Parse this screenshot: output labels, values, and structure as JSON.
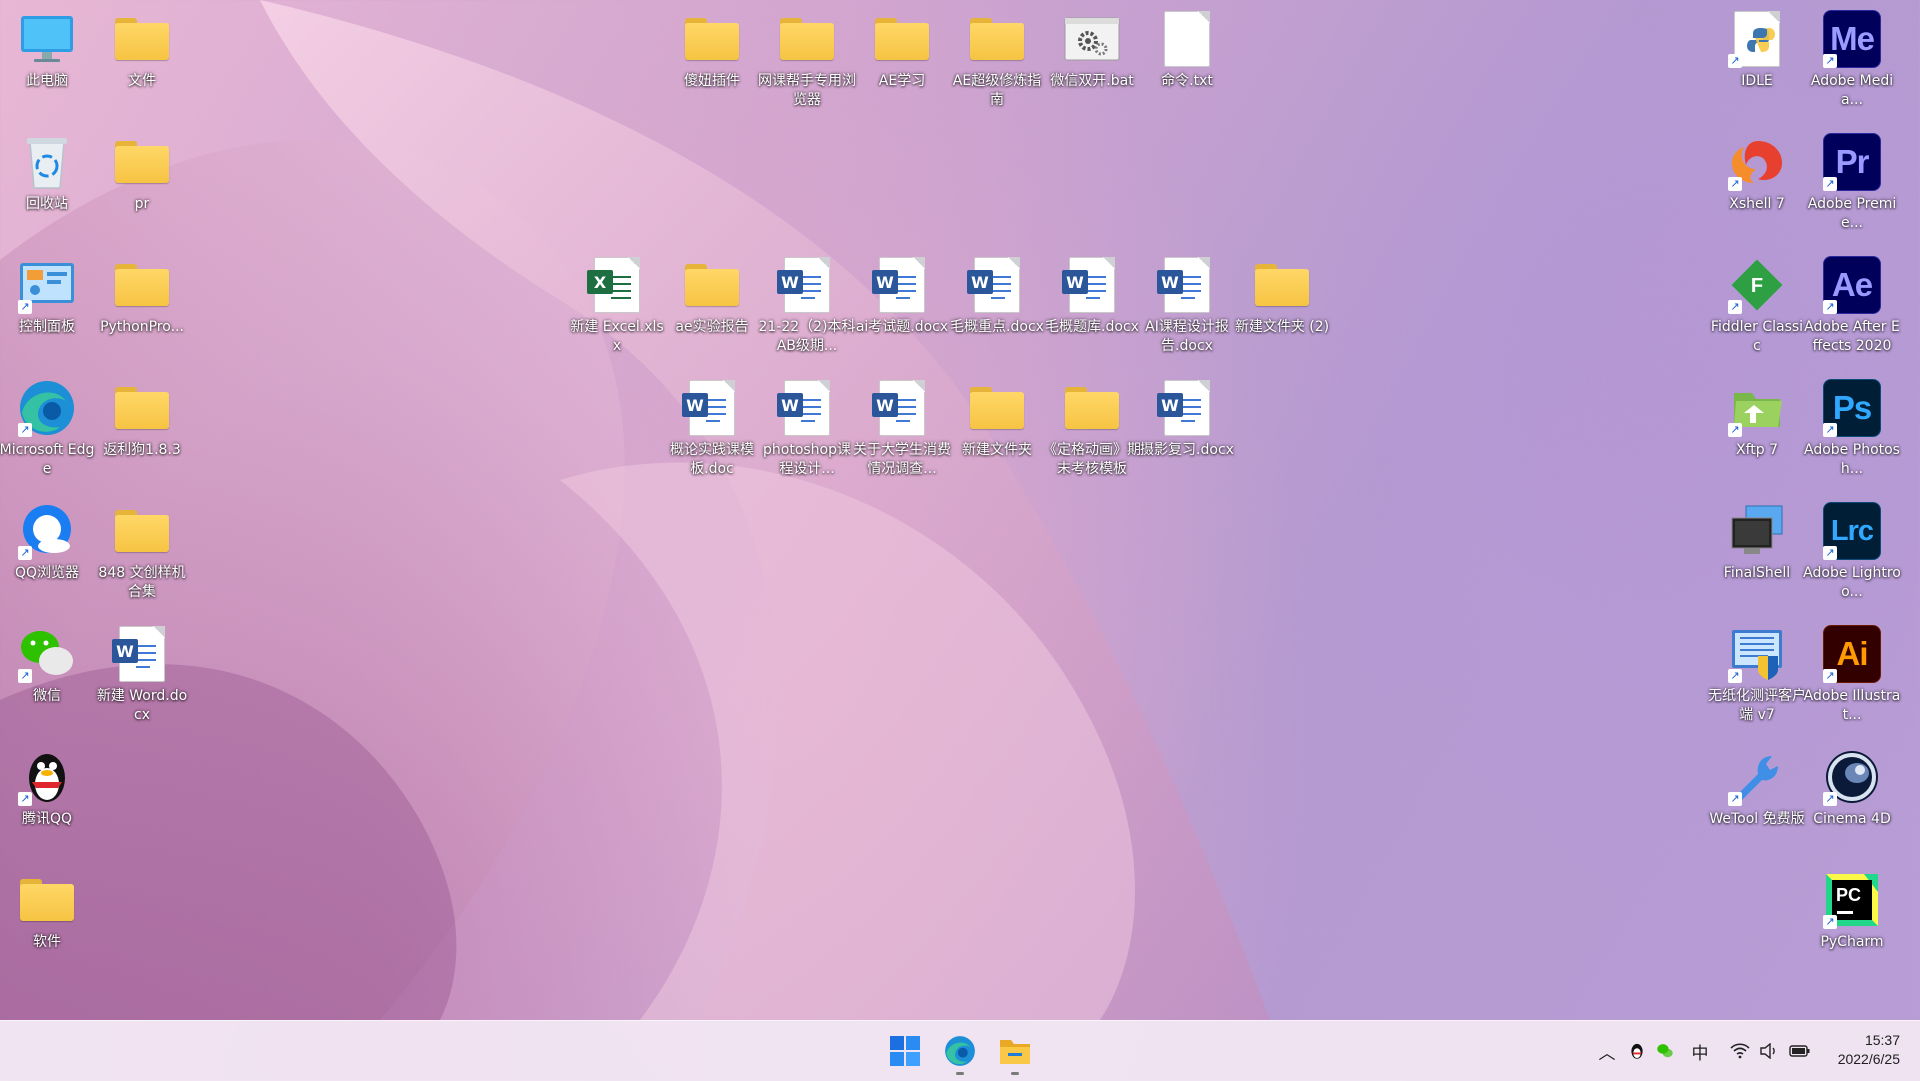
{
  "desktop": {
    "left_column": [
      {
        "label": "此电脑",
        "icon": "computer-icon"
      },
      {
        "label": "回收站",
        "icon": "recycle-bin-icon"
      },
      {
        "label": "控制面板",
        "icon": "control-panel-icon"
      },
      {
        "label": "Microsoft Edge",
        "icon": "edge-icon"
      },
      {
        "label": "QQ浏览器",
        "icon": "qq-browser-icon"
      },
      {
        "label": "微信",
        "icon": "wechat-icon"
      },
      {
        "label": "腾讯QQ",
        "icon": "qq-penguin-icon"
      },
      {
        "label": "软件",
        "icon": "folder-icon"
      }
    ],
    "second_column": [
      {
        "label": "文件",
        "icon": "folder-icon"
      },
      {
        "label": "pr",
        "icon": "folder-icon"
      },
      {
        "label": "PythonPro...",
        "icon": "folder-icon"
      },
      {
        "label": "返利狗1.8.3",
        "icon": "folder-icon"
      },
      {
        "label": "848 文创样机合集",
        "icon": "folder-icon"
      },
      {
        "label": "新建 Word.docx",
        "icon": "word-doc-icon"
      }
    ],
    "top_row": [
      {
        "label": "傻妞插件",
        "icon": "folder-icon"
      },
      {
        "label": "网课帮手专用浏览器",
        "icon": "folder-icon"
      },
      {
        "label": "AE学习",
        "icon": "folder-icon"
      },
      {
        "label": "AE超级修炼指南",
        "icon": "folder-icon"
      },
      {
        "label": "微信双开.bat",
        "icon": "batch-file-icon"
      },
      {
        "label": "命令.txt",
        "icon": "text-file-icon"
      }
    ],
    "middle_row": [
      {
        "label": "新建 Excel.xlsx",
        "icon": "excel-doc-icon"
      },
      {
        "label": "ae实验报告",
        "icon": "folder-icon"
      },
      {
        "label": "21-22（2)本科AB级期...",
        "icon": "word-doc-icon"
      },
      {
        "label": "ai考试题.docx",
        "icon": "word-doc-icon"
      },
      {
        "label": "毛概重点.docx",
        "icon": "word-doc-icon"
      },
      {
        "label": "毛概题库.docx",
        "icon": "word-doc-icon"
      },
      {
        "label": "AI课程设计报告.docx",
        "icon": "word-doc-icon"
      },
      {
        "label": "新建文件夹 (2)",
        "icon": "folder-icon"
      }
    ],
    "lower_row": [
      {
        "label": "概论实践课模板.doc",
        "icon": "word-doc-icon"
      },
      {
        "label": "photoshop课程设计...",
        "icon": "word-doc-icon"
      },
      {
        "label": "关于大学生消费情况调查...",
        "icon": "word-doc-icon"
      },
      {
        "label": "新建文件夹",
        "icon": "folder-icon"
      },
      {
        "label": "《定格动画》期末考核模板",
        "icon": "folder-icon"
      },
      {
        "label": "摄影复习.docx",
        "icon": "word-doc-icon"
      }
    ],
    "right_tools_column": [
      {
        "label": "IDLE",
        "icon": "python-idle-icon"
      },
      {
        "label": "Xshell 7",
        "icon": "xshell-icon"
      },
      {
        "label": "Fiddler Classic",
        "icon": "fiddler-icon"
      },
      {
        "label": "Xftp 7",
        "icon": "xftp-icon"
      },
      {
        "label": "FinalShell",
        "icon": "finalshell-icon"
      },
      {
        "label": "无纸化测评客户端 v7",
        "icon": "exam-client-icon"
      },
      {
        "label": "WeTool 免费版",
        "icon": "wetool-icon"
      }
    ],
    "right_adobe_column": [
      {
        "label": "Adobe Media...",
        "icon": "adobe-media-encoder-icon",
        "abbr": "Me",
        "fg": "#9a9cff",
        "bg": "#00005b"
      },
      {
        "label": "Adobe Premie...",
        "icon": "adobe-premiere-icon",
        "abbr": "Pr",
        "fg": "#9999ff",
        "bg": "#00005b"
      },
      {
        "label": "Adobe After Effects 2020",
        "icon": "adobe-after-effects-icon",
        "abbr": "Ae",
        "fg": "#9999ff",
        "bg": "#00005b"
      },
      {
        "label": "Adobe Photosh...",
        "icon": "adobe-photoshop-icon",
        "abbr": "Ps",
        "fg": "#31a8ff",
        "bg": "#001e36"
      },
      {
        "label": "Adobe Lightroo...",
        "icon": "adobe-lightroom-icon",
        "abbr": "Lrc",
        "fg": "#31a8ff",
        "bg": "#001e36"
      },
      {
        "label": "Adobe Illustrat...",
        "icon": "adobe-illustrator-icon",
        "abbr": "Ai",
        "fg": "#ff9a00",
        "bg": "#330000"
      },
      {
        "label": "Cinema 4D",
        "icon": "cinema4d-icon"
      },
      {
        "label": "PyCharm",
        "icon": "pycharm-icon",
        "abbr": "PC"
      }
    ],
    "doc_badges": {
      "word": "W",
      "excel": "X"
    }
  },
  "taskbar": {
    "pinned": [
      {
        "name": "start-button",
        "icon": "windows-start-icon"
      },
      {
        "name": "edge-taskbar-button",
        "icon": "edge-icon"
      },
      {
        "name": "file-explorer-button",
        "icon": "file-explorer-icon"
      }
    ],
    "tray": {
      "ime_label": "中",
      "time": "15:37",
      "date": "2022/6/25"
    }
  },
  "colors": {
    "word": "#2b579a",
    "excel": "#1d6f42",
    "folder": "#f6c443",
    "win_blue": "#0067c0"
  }
}
